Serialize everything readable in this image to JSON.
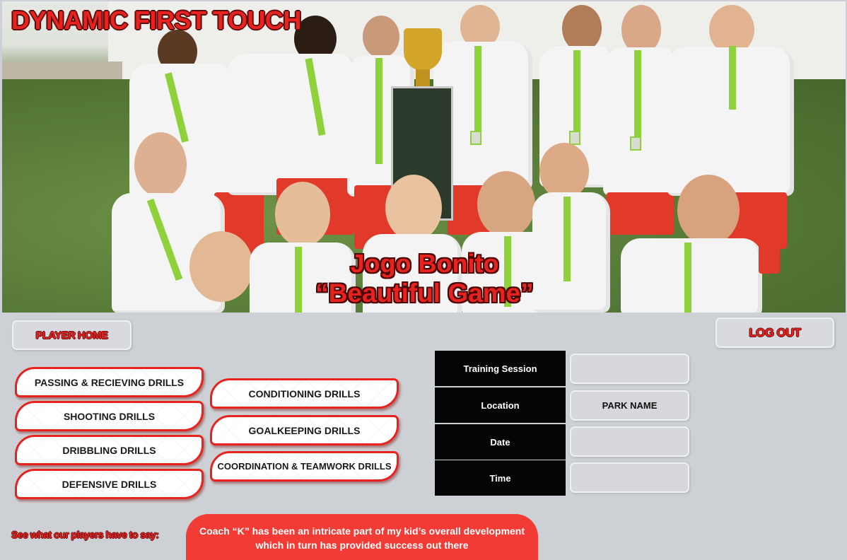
{
  "site": {
    "title": "DYNAMIC FIRST TOUCH"
  },
  "hero": {
    "image_label": "team-photo",
    "slogan_line1": "Jogo Bonito",
    "slogan_line2": "“Beautiful Game”"
  },
  "nav": {
    "player_home": "PLAYER HOME",
    "log_out": "LOG OUT"
  },
  "drills": {
    "column1": [
      "PASSING & RECIEVING DRILLS",
      "SHOOTING DRILLS",
      "DRIBBLING DRILLS",
      "DEFENSIVE DRILLS"
    ],
    "column2": [
      "CONDITIONING DRILLS",
      "GOALKEEPING DRILLS",
      "COORDINATION & TEAMWORK DRILLS"
    ]
  },
  "session": {
    "rows": [
      {
        "label": "Training Session",
        "value": ""
      },
      {
        "label": "Location",
        "value": "PARK NAME"
      },
      {
        "label": "Date",
        "value": ""
      },
      {
        "label": "Time",
        "value": ""
      }
    ]
  },
  "testimonial": {
    "prompt": "See what our players have to say:",
    "quote_line1": "Coach “K” has been an intricate part of my kid’s overall development",
    "quote_line2": "which in turn has provided success out there"
  },
  "colors": {
    "brand_red": "#e8231f",
    "page_bg": "#cdd0d4",
    "label_black": "#050505",
    "quote_red": "#f23b35"
  }
}
